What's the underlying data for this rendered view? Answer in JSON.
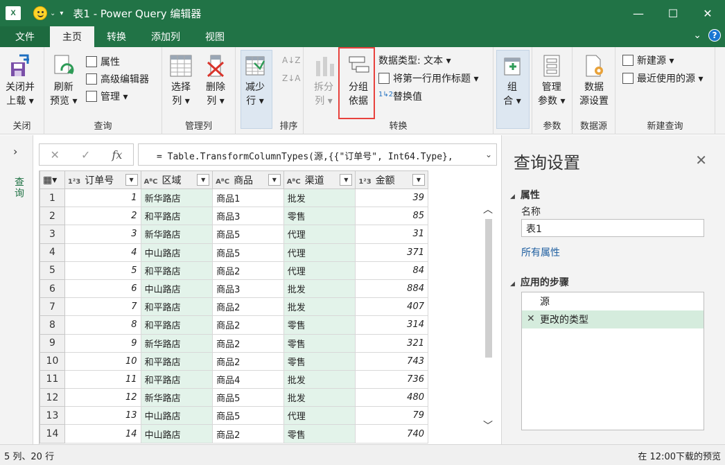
{
  "window": {
    "app_icon": "X",
    "title": "表1 - Power Query 编辑器",
    "controls": [
      "—",
      "☐",
      "✕"
    ]
  },
  "tabs": {
    "file": "文件",
    "home": "主页",
    "transform": "转换",
    "add_column": "添加列",
    "view": "视图"
  },
  "ribbon": {
    "close": {
      "btn": [
        "关闭并",
        "上载 ▾"
      ],
      "group": "关闭"
    },
    "query": {
      "refresh": [
        "刷新",
        "预览 ▾"
      ],
      "properties": "属性",
      "advanced_editor": "高级编辑器",
      "manage": "管理 ▾",
      "group": "查询"
    },
    "manage_columns": {
      "choose": [
        "选择",
        "列 ▾"
      ],
      "remove": [
        "删除",
        "列 ▾"
      ],
      "group": "管理列"
    },
    "reduce_rows": {
      "btn": [
        "减少",
        "行 ▾"
      ],
      "group": ""
    },
    "sort": {
      "group": "排序"
    },
    "transform": {
      "split": [
        "拆分",
        "列 ▾"
      ],
      "group_by": [
        "分组",
        "依据"
      ],
      "data_type": "数据类型: 文本 ▾",
      "first_row_header": "将第一行用作标题 ▾",
      "replace_values": "替换值",
      "group": "转换"
    },
    "combine": {
      "btn": [
        "组",
        "合 ▾"
      ],
      "group": ""
    },
    "parameters": {
      "btn": [
        "管理",
        "参数 ▾"
      ],
      "group": "参数"
    },
    "data_source": {
      "btn": [
        "数据",
        "源设置"
      ],
      "group": "数据源"
    },
    "new_query": {
      "new_source": "新建源 ▾",
      "recent_sources": "最近使用的源 ▾",
      "group": "新建查询"
    }
  },
  "leftnav": {
    "label": "查询"
  },
  "formula": {
    "text": "= Table.TransformColumnTypes(源,{{\"订单号\", Int64.Type},",
    "cancel": "✕",
    "confirm": "✓",
    "fx": "fx"
  },
  "table": {
    "columns": [
      {
        "type": "1²3",
        "name": "订单号"
      },
      {
        "type": "AᴮC",
        "name": "区域"
      },
      {
        "type": "AᴮC",
        "name": "商品"
      },
      {
        "type": "AᴮC",
        "name": "渠道"
      },
      {
        "type": "1²3",
        "name": "金额"
      }
    ],
    "rows": [
      [
        "1",
        "1",
        "新华路店",
        "商品1",
        "批发",
        "39"
      ],
      [
        "2",
        "2",
        "和平路店",
        "商品3",
        "零售",
        "85"
      ],
      [
        "3",
        "3",
        "新华路店",
        "商品5",
        "代理",
        "31"
      ],
      [
        "4",
        "4",
        "中山路店",
        "商品5",
        "代理",
        "371"
      ],
      [
        "5",
        "5",
        "和平路店",
        "商品2",
        "代理",
        "84"
      ],
      [
        "6",
        "6",
        "中山路店",
        "商品3",
        "批发",
        "884"
      ],
      [
        "7",
        "7",
        "和平路店",
        "商品2",
        "批发",
        "407"
      ],
      [
        "8",
        "8",
        "和平路店",
        "商品2",
        "零售",
        "314"
      ],
      [
        "9",
        "9",
        "新华路店",
        "商品2",
        "零售",
        "321"
      ],
      [
        "10",
        "10",
        "和平路店",
        "商品2",
        "零售",
        "743"
      ],
      [
        "11",
        "11",
        "和平路店",
        "商品4",
        "批发",
        "736"
      ],
      [
        "12",
        "12",
        "新华路店",
        "商品5",
        "批发",
        "480"
      ],
      [
        "13",
        "13",
        "中山路店",
        "商品5",
        "代理",
        "79"
      ],
      [
        "14",
        "14",
        "中山路店",
        "商品2",
        "零售",
        "740"
      ]
    ]
  },
  "settings": {
    "title": "查询设置",
    "properties_header": "属性",
    "name_label": "名称",
    "name_value": "表1",
    "all_properties": "所有属性",
    "applied_steps_header": "应用的步骤",
    "steps": [
      "源",
      "更改的类型"
    ]
  },
  "status": {
    "left": "5 列、20 行",
    "right": "在 12:00下载的预览"
  },
  "colors": {
    "brand": "#217346",
    "highlight": "#e8413c",
    "text_col_bg": "#e3f3ea"
  }
}
